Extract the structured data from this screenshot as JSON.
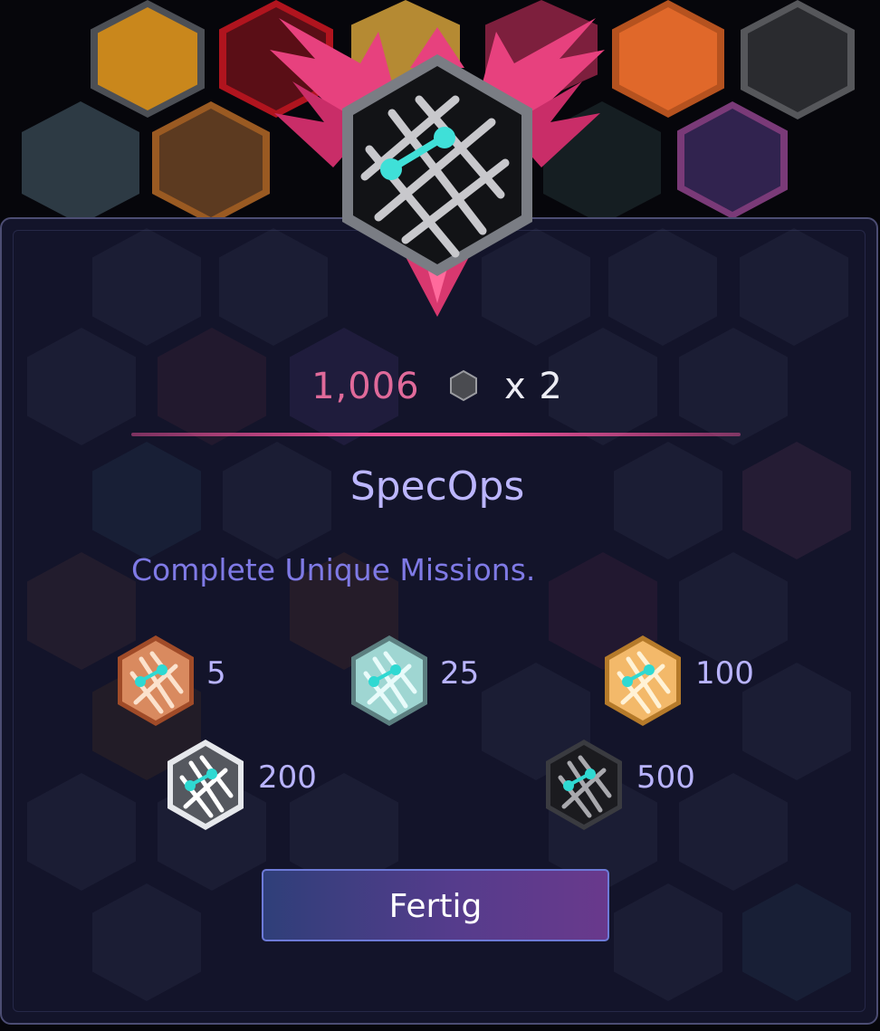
{
  "badge": {
    "name": "SpecOps",
    "description": "Complete Unique Missions.",
    "icon": "specops-badge-icon"
  },
  "score": {
    "value": "1,006",
    "icon": "hexagon-icon",
    "multiplier": "x 2"
  },
  "tiers": [
    {
      "label": "5",
      "tier": "bronze",
      "color": "#d98a5f"
    },
    {
      "label": "25",
      "tier": "silver",
      "color": "#9fd6d2"
    },
    {
      "label": "100",
      "tier": "gold",
      "color": "#f3b96a"
    },
    {
      "label": "200",
      "tier": "platinum",
      "color": "#d9dde3"
    },
    {
      "label": "500",
      "tier": "onyx",
      "color": "#1b1b1f"
    }
  ],
  "actions": {
    "done_label": "Fertig"
  },
  "colors": {
    "accent": "#e95096",
    "title": "#bcb6ff",
    "panel": "#13142a",
    "button": "#553c8c"
  }
}
